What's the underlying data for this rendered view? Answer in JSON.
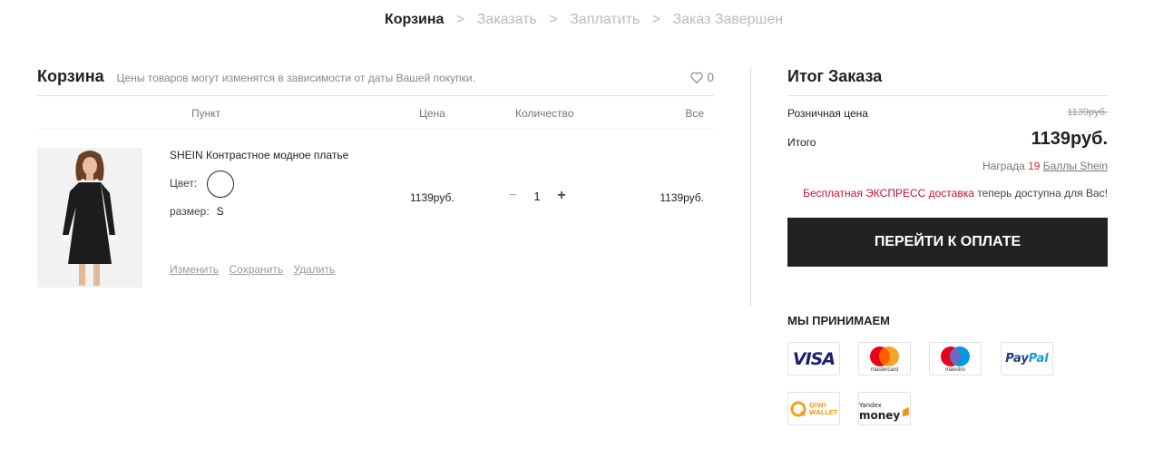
{
  "steps": [
    "Корзина",
    "Заказать",
    "Заплатить",
    "Заказ Завершен"
  ],
  "step_separator": ">",
  "cart": {
    "title": "Корзина",
    "note": "Цены товаров могут изменятся в зависимости от даты Вашей покупки.",
    "wishlist_count": "0",
    "columns": {
      "item": "Пункт",
      "price": "Цена",
      "quantity": "Количество",
      "total": "Все"
    },
    "item": {
      "name": "SHEIN Контрастное модное платье",
      "color_label": "Цвет:",
      "size_label": "размер:",
      "size_value": "S",
      "price": "1139руб.",
      "quantity": "1",
      "minus": "−",
      "plus": "+",
      "total": "1139руб.",
      "actions": {
        "edit": "Изменить",
        "save": "Сохранить",
        "delete": "Удалить"
      }
    }
  },
  "summary": {
    "title": "Итог Заказа",
    "retail_label": "Розничная цена",
    "retail_value": "1139руб.",
    "total_label": "Итого",
    "total_value": "1139руб.",
    "reward_label": "Награда",
    "reward_points": "19",
    "reward_link": "Баллы Shein",
    "express_highlight": "Бесплатная ЭКСПРЕСС доставка",
    "express_rest": "теперь доступна для Вас!",
    "checkout_label": "ПЕРЕЙТИ К ОПЛАТЕ"
  },
  "payments": {
    "title": "МЫ ПРИНИМАЕМ",
    "methods": {
      "visa": "VISA",
      "mastercard": "mastercard",
      "maestro": "maestro",
      "paypal_pay": "Pay",
      "paypal_pal": "Pal",
      "qiwi_1": "QIWI",
      "qiwi_2": "WALLET",
      "yandex_1": "Yandex",
      "yandex_2": "money"
    }
  },
  "colors": {
    "accent_red": "#c8102e",
    "button_bg": "#222222"
  }
}
